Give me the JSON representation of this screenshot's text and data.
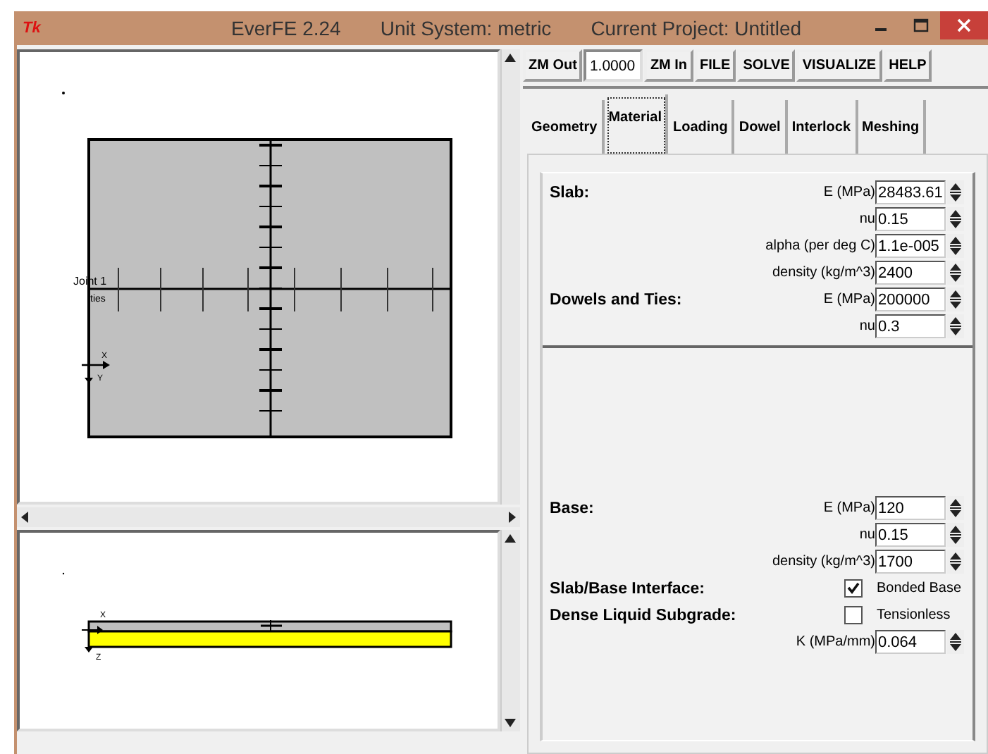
{
  "window": {
    "app_icon": "Tk",
    "title_parts": [
      "EverFE 2.24",
      "Unit System: metric",
      "Current Project: Untitled"
    ]
  },
  "toolbar": {
    "zoom_out": "ZM Out",
    "zoom_value": "1.0000",
    "zoom_in": "ZM In",
    "menus": [
      "FILE",
      "SOLVE",
      "VISUALIZE",
      "HELP"
    ]
  },
  "tabs": [
    {
      "label": "Geometry",
      "selected": false
    },
    {
      "label": "Material",
      "selected": true
    },
    {
      "label": "Loading",
      "selected": false
    },
    {
      "label": "Dowel",
      "selected": false
    },
    {
      "label": "Interlock",
      "selected": false
    },
    {
      "label": "Meshing",
      "selected": false
    }
  ],
  "plan_view": {
    "joint_label": "Joint 1",
    "tie_label": "ties",
    "axis_x": "X",
    "axis_y": "Y"
  },
  "section_view": {
    "axis_x": "X",
    "axis_z": "Z"
  },
  "upper_group": [
    {
      "kind": "field",
      "heading": "Slab:",
      "label": "E (MPa)",
      "value": "28483.61"
    },
    {
      "kind": "field",
      "label": "nu",
      "value": "0.15"
    },
    {
      "kind": "field",
      "label": "alpha (per deg C)",
      "value": "1.1e-005"
    },
    {
      "kind": "field",
      "label": "density (kg/m^3)",
      "value": "2400"
    },
    {
      "kind": "field",
      "heading": "Dowels and Ties:",
      "label": "E (MPa)",
      "value": "200000"
    },
    {
      "kind": "field",
      "label": "nu",
      "value": "0.3"
    }
  ],
  "lower_group": [
    {
      "kind": "field",
      "heading": "Base:",
      "label": "E (MPa)",
      "value": "120"
    },
    {
      "kind": "field",
      "label": "nu",
      "value": "0.15"
    },
    {
      "kind": "field",
      "label": "density (kg/m^3)",
      "value": "1700"
    },
    {
      "kind": "checkbox",
      "heading": "Slab/Base Interface:",
      "label": "Bonded Base",
      "checked": true
    },
    {
      "kind": "checkbox",
      "heading": "Dense Liquid Subgrade:",
      "label": "Tensionless",
      "checked": false
    },
    {
      "kind": "field",
      "label": "K (MPa/mm)",
      "value": "0.064"
    }
  ]
}
